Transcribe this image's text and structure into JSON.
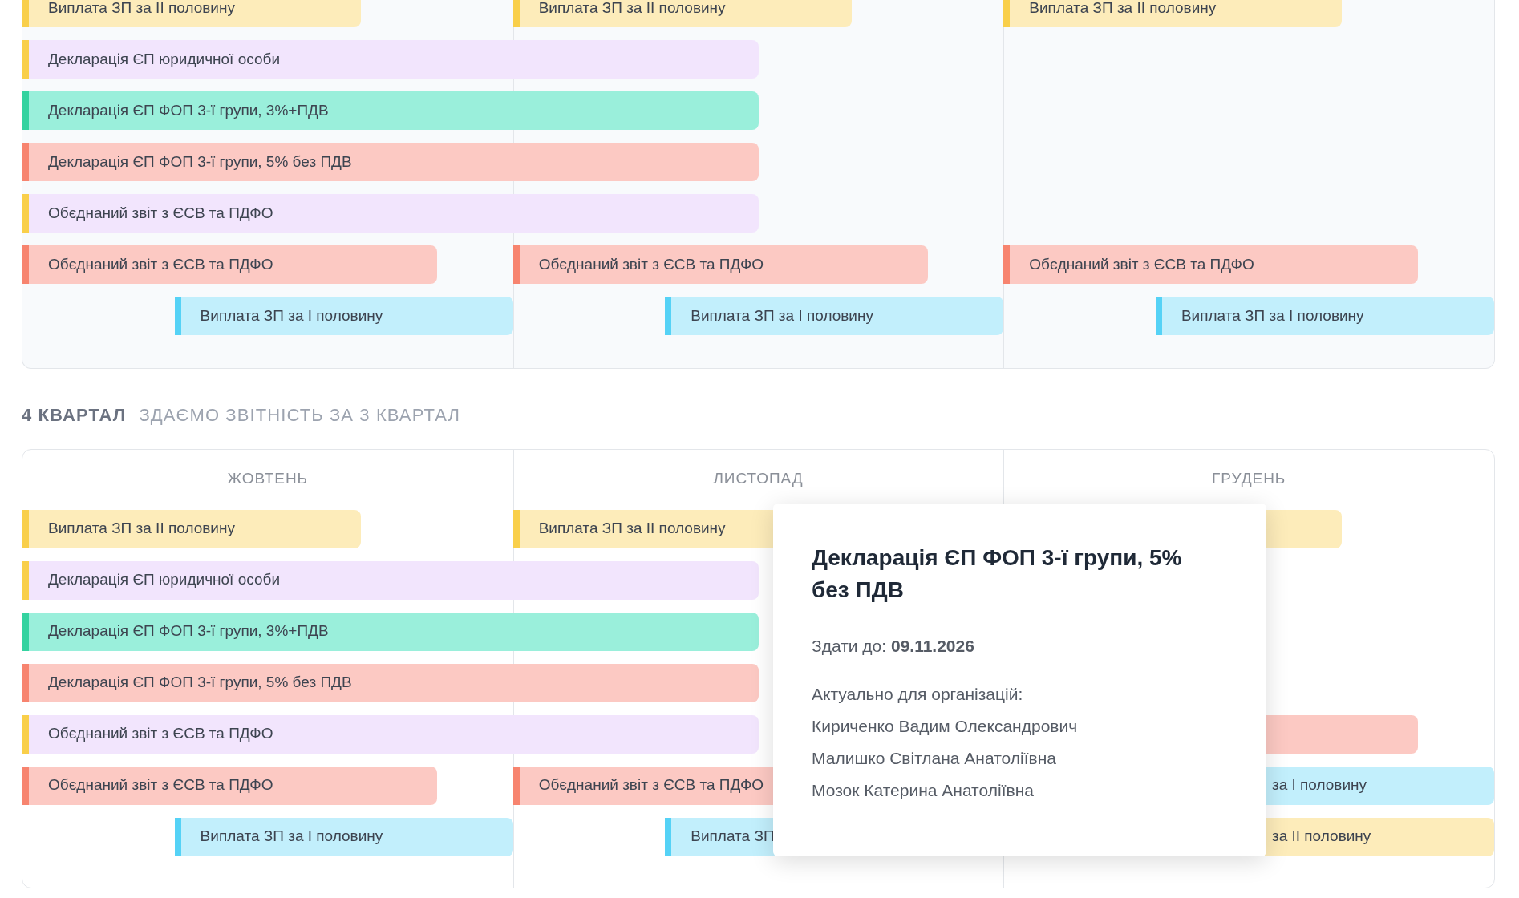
{
  "quarters": [
    {
      "lanes": [
        {
          "cells": [
            {
              "kind": "short",
              "color": "#fdecba",
              "text": "Виплата ЗП за ІІ половину"
            },
            {
              "kind": "short",
              "color": "#fdecba",
              "text": "Виплата ЗП за ІІ половину"
            },
            {
              "kind": "short",
              "color": "#fdecba",
              "text": "Виплата ЗП за ІІ половину"
            }
          ]
        },
        {
          "cells": [
            {
              "kind": "long",
              "color": "#f2e5fd",
              "text": "Декларація ЄП юридичної особи"
            },
            null,
            null
          ]
        },
        {
          "cells": [
            {
              "kind": "long",
              "color": "#9aefdb",
              "text": "Декларація ЄП ФОП 3-ї групи, 3%+ПДВ"
            },
            null,
            null
          ]
        },
        {
          "cells": [
            {
              "kind": "long",
              "color": "#fcc9c3",
              "text": "Декларація ЄП ФОП 3-ї групи, 5% без ПДВ"
            },
            null,
            null
          ]
        },
        {
          "cells": [
            {
              "kind": "long",
              "color": "#f2e5fd",
              "text": "Обєднаний звіт з ЄСВ та ПДФО"
            },
            null,
            null
          ]
        },
        {
          "cells": [
            {
              "kind": "medium",
              "color": "#fcc9c3",
              "text": "Обєднаний звіт з ЄСВ та ПДФО"
            },
            {
              "kind": "medium",
              "color": "#fcc9c3",
              "text": "Обєднаний звіт з ЄСВ та ПДФО"
            },
            {
              "kind": "medium",
              "color": "#fcc9c3",
              "text": "Обєднаний звіт з ЄСВ та ПДФО"
            }
          ]
        },
        {
          "cells": [
            {
              "kind": "late",
              "color": "#c2effc",
              "text": "Виплата ЗП за І половину"
            },
            {
              "kind": "late",
              "color": "#c2effc",
              "text": "Виплата ЗП за І половину"
            },
            {
              "kind": "late",
              "color": "#c2effc",
              "text": "Виплата ЗП за І половину"
            }
          ]
        }
      ]
    },
    {
      "title": "4 КВАРТАЛ",
      "subtitle": "ЗДАЄМО ЗВІТНІСТЬ ЗА 3 КВАРТАЛ",
      "months": [
        "ЖОВТЕНЬ",
        "ЛИСТОПАД",
        "ГРУДЕНЬ"
      ],
      "lanes": [
        {
          "cells": [
            {
              "kind": "short",
              "color": "#fdecba",
              "text": "Виплата ЗП за ІІ половину"
            },
            {
              "kind": "short",
              "color": "#fdecba",
              "text": "Виплата ЗП за ІІ половину"
            },
            {
              "kind": "short",
              "color": "#fdecba"
            }
          ]
        },
        {
          "cells": [
            {
              "kind": "long",
              "color": "#f2e5fd",
              "text": "Декларація ЄП юридичної особи"
            },
            null,
            null
          ]
        },
        {
          "cells": [
            {
              "kind": "long",
              "color": "#9aefdb",
              "text": "Декларація ЄП ФОП 3-ї групи, 3%+ПДВ"
            },
            null,
            null
          ]
        },
        {
          "cells": [
            {
              "kind": "long",
              "color": "#fcc9c3",
              "text": "Декларація ЄП ФОП 3-ї групи, 5% без ПДВ"
            },
            null,
            null
          ]
        },
        {
          "cells": [
            {
              "kind": "long",
              "color": "#f2e5fd",
              "text": "Обєднаний звіт з ЄСВ та ПДФО"
            },
            null,
            {
              "kind": "medium",
              "color": "#fcc9c3"
            }
          ]
        },
        {
          "cells": [
            {
              "kind": "medium",
              "color": "#fcc9c3",
              "text": "Обєднаний звіт з ЄСВ та ПДФО"
            },
            {
              "kind": "medium",
              "color": "#fcc9c3",
              "text": "Обєднаний звіт з ЄСВ та ПДФО"
            },
            {
              "kind": "late",
              "color": "#c2effc",
              "text": "за І половину",
              "covered": true
            }
          ]
        },
        {
          "cells": [
            {
              "kind": "late",
              "color": "#c2effc",
              "text": "Виплата ЗП за І половину"
            },
            {
              "kind": "late",
              "color": "#c2effc",
              "text": "Виплата ЗП"
            },
            {
              "kind": "late",
              "color": "#fdecba",
              "text": "за ІІ половину",
              "covered": true
            }
          ]
        }
      ]
    }
  ],
  "tooltip": {
    "title": "Декларація ЄП ФОП 3-ї групи, 5% без ПДВ",
    "deadline_label": "Здати до:",
    "deadline": "09.11.2026",
    "orgs_label": "Актуально для організацій:",
    "orgs": [
      "Кириченко Вадим Олександрович",
      "Малишко Світлана Анатоліївна",
      "Мозок Катерина Анатоліївна"
    ]
  }
}
